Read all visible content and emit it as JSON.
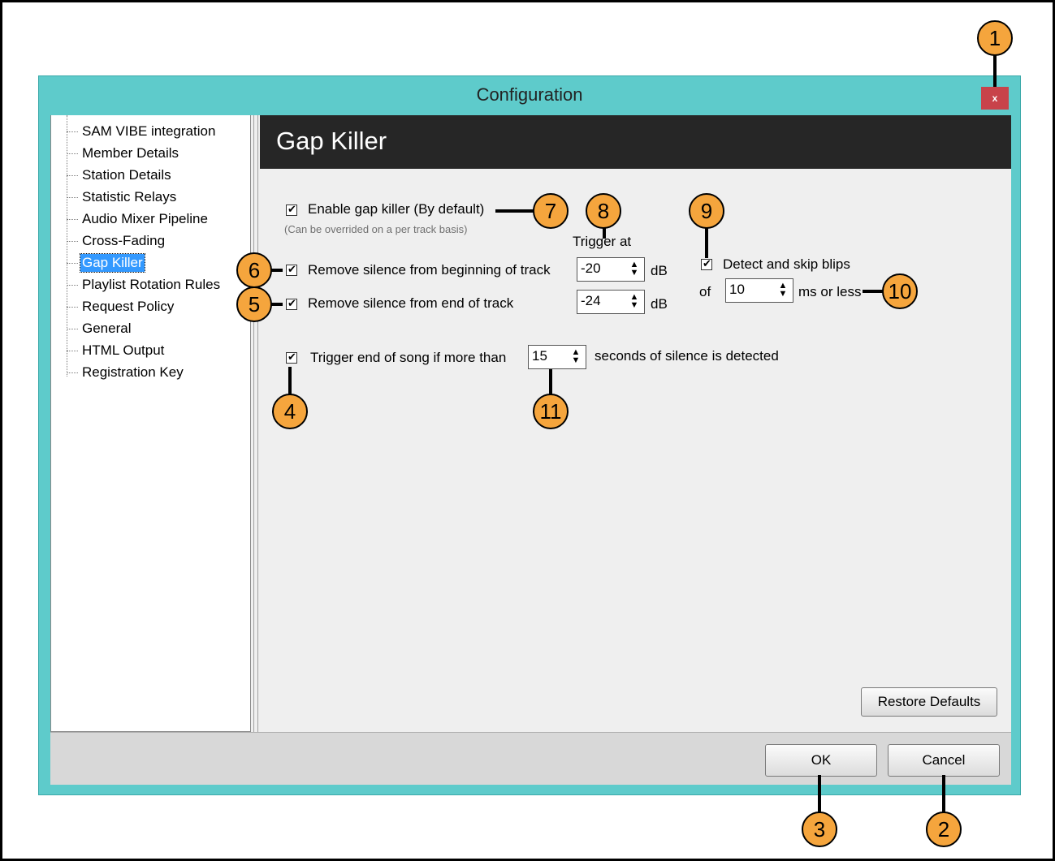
{
  "window": {
    "title": "Configuration",
    "close_label": "x",
    "accent_color": "#5ecbcb",
    "close_color": "#c8434a"
  },
  "sidebar": {
    "items": [
      {
        "label": "SAM VIBE integration"
      },
      {
        "label": "Member Details"
      },
      {
        "label": "Station Details"
      },
      {
        "label": "Statistic Relays"
      },
      {
        "label": "Audio Mixer Pipeline"
      },
      {
        "label": "Cross-Fading"
      },
      {
        "label": "Gap Killer",
        "selected": true
      },
      {
        "label": "Playlist Rotation Rules"
      },
      {
        "label": "Request Policy"
      },
      {
        "label": "General"
      },
      {
        "label": "HTML Output"
      },
      {
        "label": "Registration Key"
      }
    ]
  },
  "panel": {
    "title": "Gap Killer",
    "enable": {
      "label": "Enable gap killer (By default)",
      "note": "(Can be overrided on a per track basis)",
      "checked": true
    },
    "trigger_header": "Trigger at",
    "remove_begin": {
      "label": "Remove silence from beginning of track",
      "value": "-20",
      "unit": "dB",
      "checked": true
    },
    "remove_end": {
      "label": "Remove silence from end of track",
      "value": "-24",
      "unit": "dB",
      "checked": true
    },
    "blips": {
      "label": "Detect and skip blips",
      "of_label": "of",
      "value": "10",
      "unit": "ms or less",
      "checked": true
    },
    "trigger_end": {
      "label": "Trigger end of song if more than",
      "value": "15",
      "suffix": "seconds of silence is detected",
      "checked": true
    },
    "restore_label": "Restore Defaults"
  },
  "footer": {
    "ok_label": "OK",
    "cancel_label": "Cancel"
  },
  "callouts": [
    "1",
    "2",
    "3",
    "4",
    "5",
    "6",
    "7",
    "8",
    "9",
    "10",
    "11"
  ]
}
